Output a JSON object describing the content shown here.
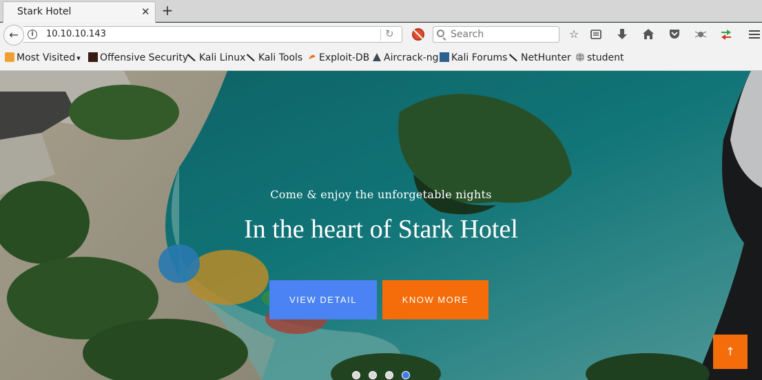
{
  "browser": {
    "tab_title": "Stark Hotel",
    "tab_close": "✕",
    "new_tab": "+",
    "url": "10.10.10.143",
    "search_placeholder": "Search"
  },
  "bookmarks": [
    {
      "label": "Most Visited",
      "icon": "rss-folder-icon"
    },
    {
      "label": "Offensive Security",
      "icon": "offsec-icon"
    },
    {
      "label": "Kali Linux",
      "icon": "kali-dragon-icon"
    },
    {
      "label": "Kali Tools",
      "icon": "kali-dragon-icon"
    },
    {
      "label": "Exploit-DB",
      "icon": "exploitdb-icon"
    },
    {
      "label": "Aircrack-ng",
      "icon": "aircrack-icon"
    },
    {
      "label": "Kali Forums",
      "icon": "kali-forums-icon"
    },
    {
      "label": "NetHunter",
      "icon": "kali-dragon-icon"
    },
    {
      "label": "student",
      "icon": "globe-icon"
    }
  ],
  "hero": {
    "subtitle": "Come & enjoy the unforgetable nights",
    "title": "In the heart of Stark Hotel",
    "view_detail": "VIEW DETAIL",
    "know_more": "KNOW MORE",
    "slides_total": 4,
    "active_slide": 4,
    "scroll_top_icon": "↑"
  },
  "colors": {
    "view_button": "#4b83f5",
    "know_button": "#f56d0a",
    "active_dot": "#3f7af2"
  }
}
